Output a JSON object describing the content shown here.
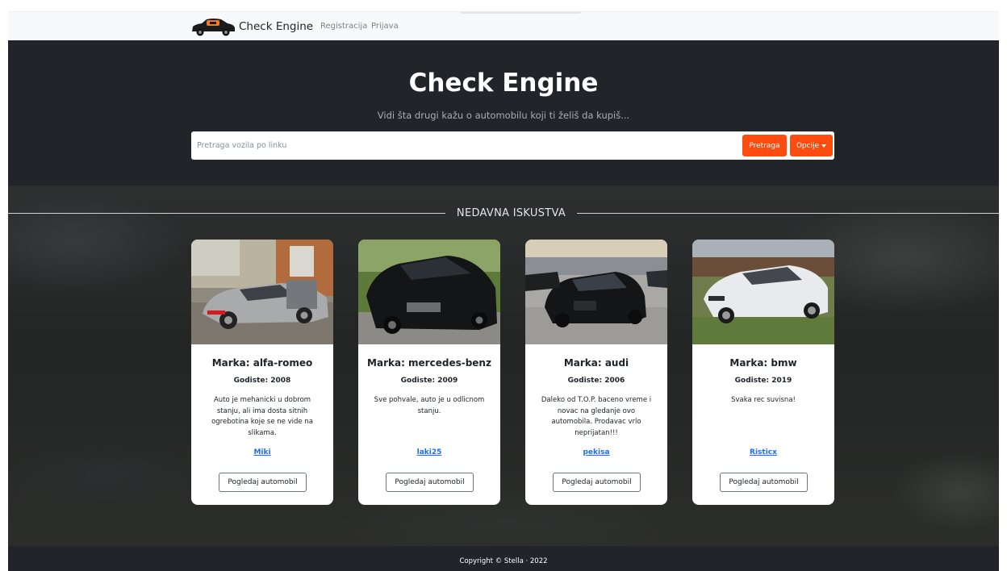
{
  "navbar": {
    "brand_text": "Check Engine",
    "links": [
      "Registracija",
      "Prijava"
    ],
    "logo_icon": "car-check-engine-logo"
  },
  "hero": {
    "title": "Check Engine",
    "subtitle": "Vidi šta drugi kažu o automobilu koji ti želiš da kupiš...",
    "search_placeholder": "Pretraga vozila po linku",
    "search_value": "",
    "search_button": "Pretraga",
    "options_button": "Opcije"
  },
  "section": {
    "title": "NEDAVNA ISKUSTVA"
  },
  "cards": [
    {
      "title": "Marka: alfa-romeo",
      "year": "Godiste: 2008",
      "text": "Auto je mehanicki u dobrom stanju, ali ima dosta sitnih ogrebotina koje se ne vide na slikama.",
      "author": "Miki",
      "button": "Pogledaj automobil",
      "image": "silver-sedan-photo"
    },
    {
      "title": "Marka: mercedes-benz",
      "year": "Godiste: 2009",
      "text": "Sve pohvale, auto je u odlicnom stanju.",
      "author": "laki25",
      "button": "Pogledaj automobil",
      "image": "black-sedan-photo"
    },
    {
      "title": "Marka: audi",
      "year": "Godiste: 2006",
      "text": "Daleko od T.O.P. baceno vreme i novac na gledanje ovo automobila. Prodavac vrlo neprijatan!!!",
      "author": "pekisa",
      "button": "Pogledaj automobil",
      "image": "black-hatchback-photo"
    },
    {
      "title": "Marka: bmw",
      "year": "Godiste: 2019",
      "text": "Svaka rec suvisna!",
      "author": "Risticx",
      "button": "Pogledaj automobil",
      "image": "white-coupe-photo"
    }
  ],
  "footer": {
    "text": "Copyright © Stella · 2022"
  },
  "colors": {
    "accent": "#fd4c10",
    "dark": "#212529",
    "link": "#1a6ef0"
  }
}
